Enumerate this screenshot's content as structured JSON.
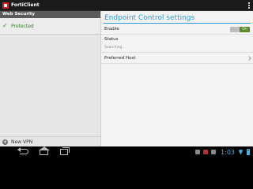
{
  "app": {
    "title": "FortiClient"
  },
  "left": {
    "section_header": "Web Security",
    "status": "Protected",
    "new_vpn_label": "New VPN"
  },
  "right": {
    "title": "Endpoint Control settings",
    "enable_label": "Enable",
    "toggle_value": "On",
    "status_label": "Status",
    "status_value": "Searching...",
    "preferred_host_label": "Preferred Host"
  },
  "system": {
    "time": "1:03"
  },
  "colors": {
    "accent": "#2f9bd4",
    "protected": "#2e7d22",
    "toggle_on": "#5c8a28"
  }
}
